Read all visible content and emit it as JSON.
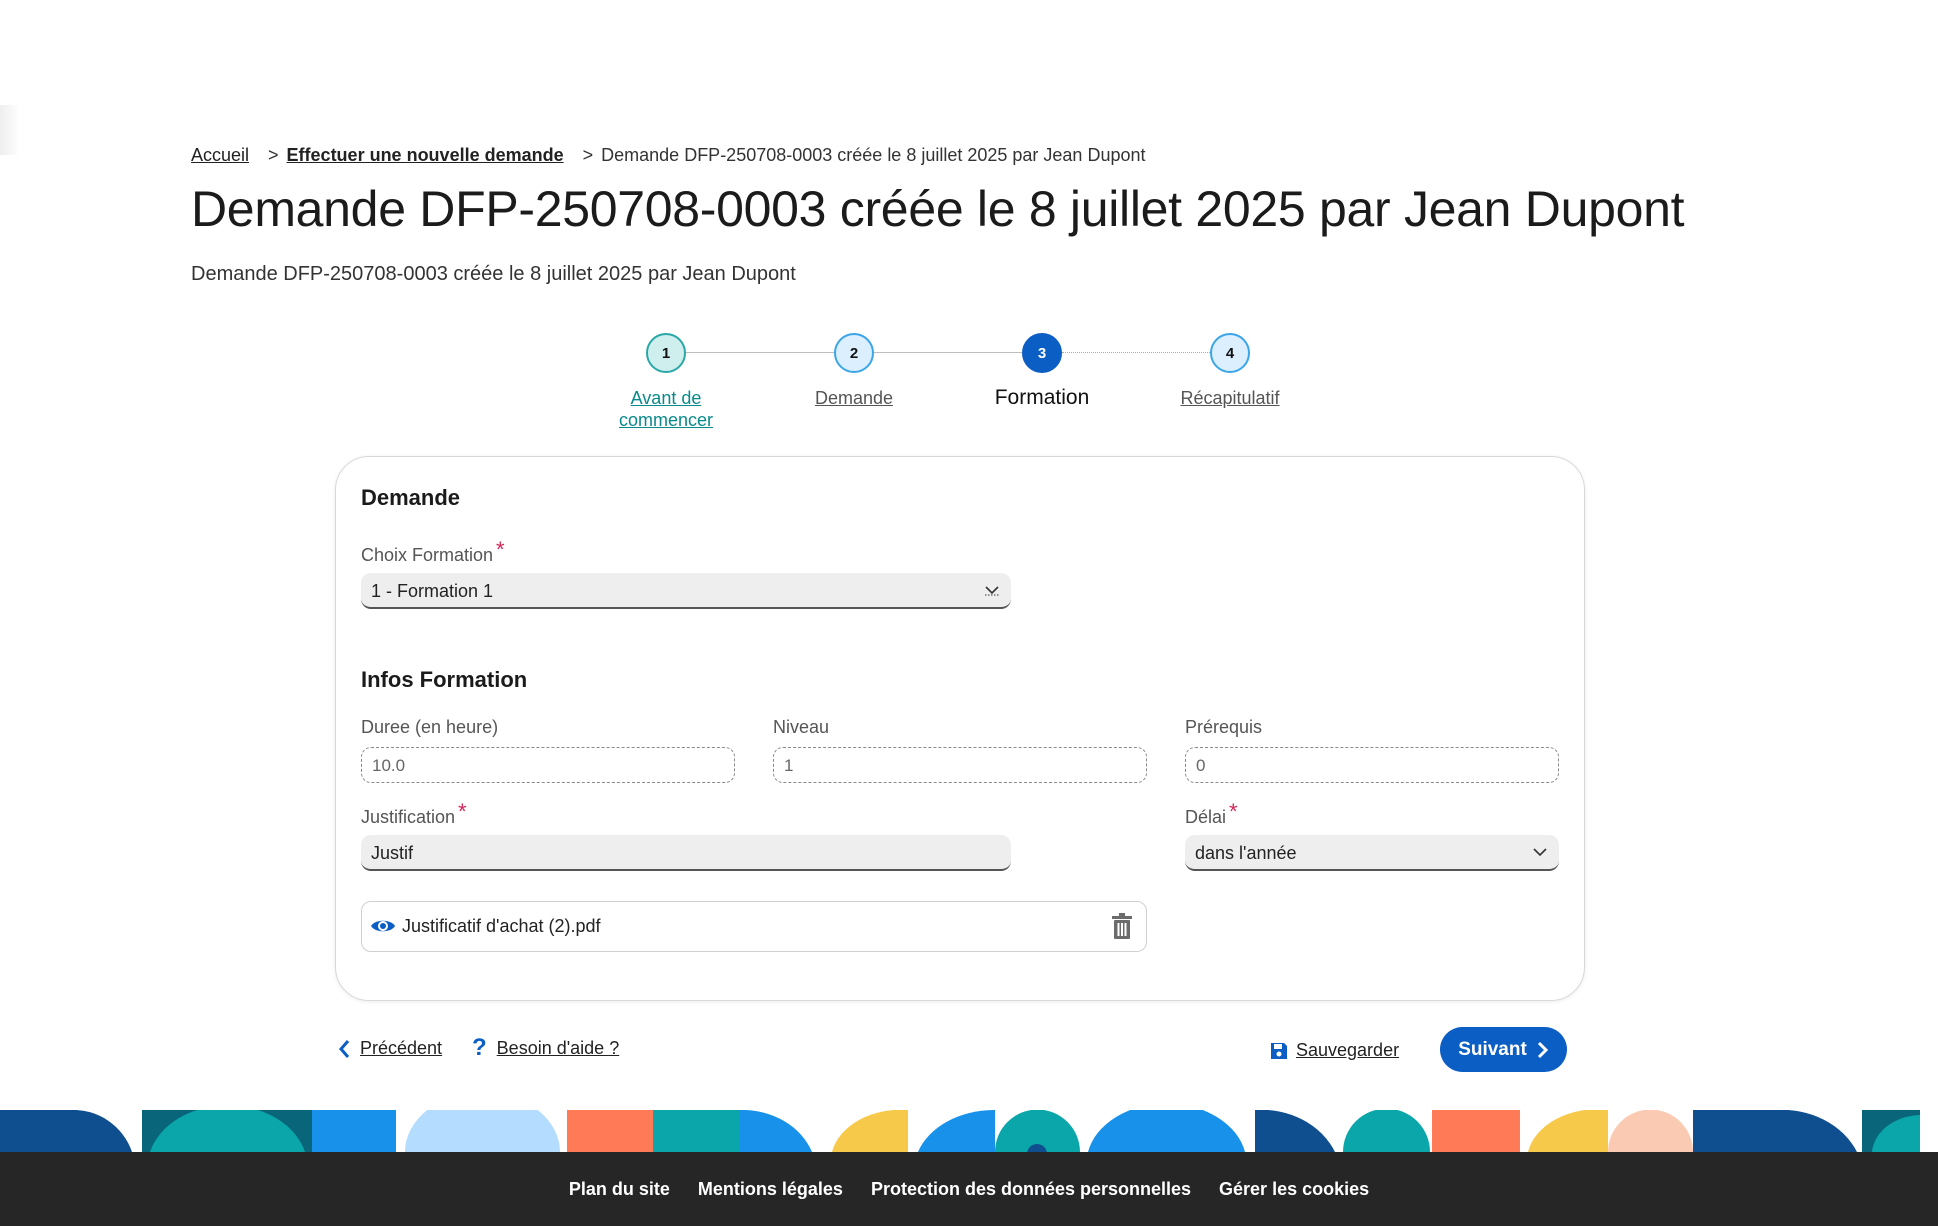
{
  "breadcrumb": {
    "home": "Accueil",
    "sep": ">",
    "new_request": "Effectuer une nouvelle demande",
    "current": "Demande DFP-250708-0003 créée le 8 juillet 2025 par Jean Dupont"
  },
  "page": {
    "title": "Demande DFP-250708-0003 créée le 8 juillet 2025 par Jean Dupont",
    "subtitle": "Demande DFP-250708-0003 créée le 8 juillet 2025 par Jean Dupont"
  },
  "stepper": {
    "steps": [
      {
        "number": "1",
        "label_line1": "Avant de",
        "label_line2": "commencer",
        "state": "completed"
      },
      {
        "number": "2",
        "label_line1": "Demande",
        "label_line2": "",
        "state": "visited"
      },
      {
        "number": "3",
        "label_line1": "Formation",
        "label_line2": "",
        "state": "current"
      },
      {
        "number": "4",
        "label_line1": "Récapitulatif",
        "label_line2": "",
        "state": "upcoming"
      }
    ]
  },
  "demande": {
    "section_title": "Demande",
    "choix_label": "Choix Formation",
    "required_mark": "*",
    "choix_value": "1 - Formation 1"
  },
  "infos": {
    "section_title": "Infos Formation",
    "duree_label": "Duree (en heure)",
    "duree_value": "10.0",
    "niveau_label": "Niveau",
    "niveau_value": "1",
    "prerequis_label": "Prérequis",
    "prerequis_value": "0",
    "justification_label": "Justification",
    "justification_value": "Justif",
    "delai_label": "Délai",
    "delai_value": "dans l'année",
    "file_name": "Justificatif d'achat (2).pdf"
  },
  "nav": {
    "prev_label": "Précédent",
    "help_label": "Besoin d'aide ?",
    "save_label": "Sauvegarder",
    "next_label": "Suivant"
  },
  "footer": {
    "links": [
      "Plan du site",
      "Mentions légales",
      "Protection des données personnelles",
      "Gérer les cookies"
    ]
  },
  "colors": {
    "primary": "#0b5ec4",
    "teal": "#2aa7a7",
    "required": "#d4285c",
    "footer_bg": "#262626"
  }
}
